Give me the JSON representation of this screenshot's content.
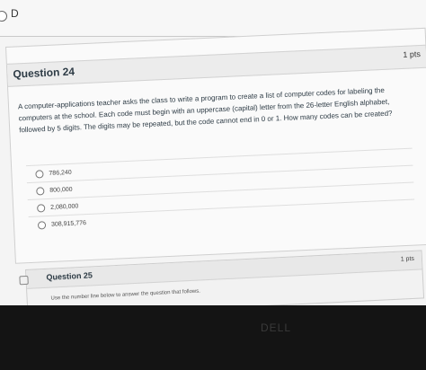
{
  "previous": {
    "option_label": "D"
  },
  "question24": {
    "title": "Question 24",
    "points": "1 pts",
    "text": "A computer-applications teacher asks the class to write a program to create a list of computer codes for labeling the computers at the school. Each code must begin with an uppercase (capital) letter from the 26-letter English alphabet, followed by 5 digits. The digits may be repeated, but the code cannot end in 0 or 1. How many codes can be created?",
    "answers": [
      {
        "label": "786,240"
      },
      {
        "label": "800,000"
      },
      {
        "label": "2,080,000"
      },
      {
        "label": "308,915,776"
      }
    ]
  },
  "question25": {
    "title": "Question 25",
    "points": "1 pts",
    "text": "Use the number line below to answer the question that follows."
  },
  "monitor": {
    "brand": "DELL"
  }
}
